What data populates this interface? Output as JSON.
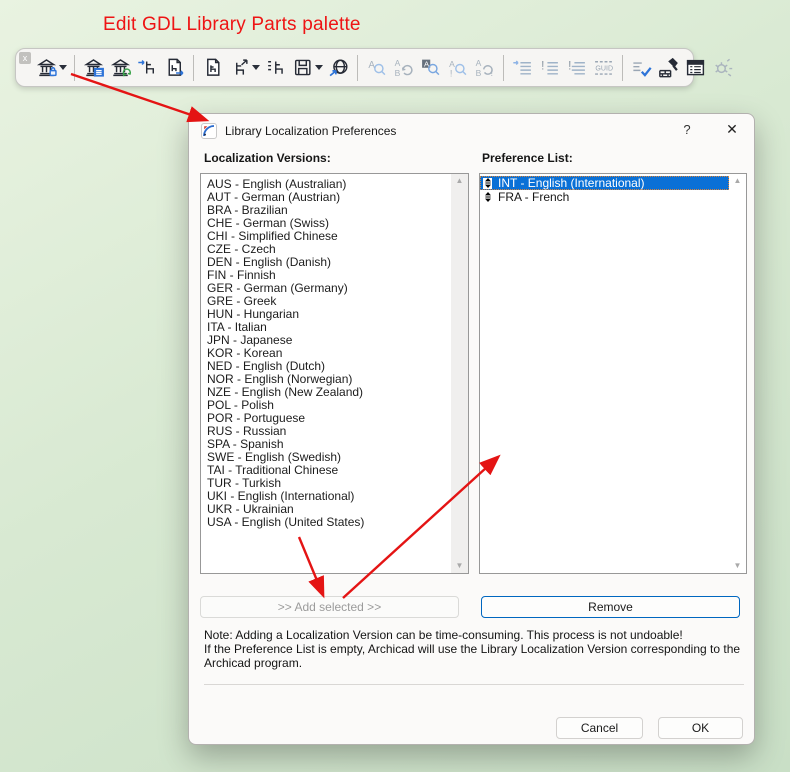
{
  "annotation": {
    "label": "Edit GDL Library Parts palette",
    "color": "#ee1414"
  },
  "toolbar": {
    "close_label": "x",
    "buttons": [
      {
        "name": "library-lock",
        "caret": true,
        "disabled": false
      },
      {
        "sep": true
      },
      {
        "name": "library-manager",
        "disabled": false
      },
      {
        "name": "reload-libraries",
        "disabled": false
      },
      {
        "name": "open-object",
        "disabled": false
      },
      {
        "name": "export-object",
        "disabled": false
      },
      {
        "sep": true
      },
      {
        "name": "new-object",
        "disabled": false
      },
      {
        "name": "open-object-subwindow",
        "caret": true,
        "disabled": false
      },
      {
        "name": "object-parameters",
        "disabled": false
      },
      {
        "name": "save-object",
        "caret": true,
        "disabled": false
      },
      {
        "name": "open-object-from-web",
        "disabled": false
      },
      {
        "sep": true
      },
      {
        "name": "find",
        "disabled": true
      },
      {
        "name": "find-replace",
        "disabled": true
      },
      {
        "name": "find-selection",
        "disabled": false
      },
      {
        "name": "find-next",
        "disabled": true
      },
      {
        "name": "replace-all",
        "disabled": true
      },
      {
        "sep": true
      },
      {
        "name": "indent-lines",
        "disabled": true
      },
      {
        "name": "comment-lines",
        "disabled": true
      },
      {
        "name": "uncomment-lines",
        "disabled": true
      },
      {
        "name": "insert-guid",
        "disabled": true
      },
      {
        "sep": true
      },
      {
        "name": "check-script",
        "disabled": false
      },
      {
        "name": "rebuild",
        "disabled": false
      },
      {
        "name": "editor-grid",
        "disabled": false
      },
      {
        "name": "debug",
        "disabled": true
      }
    ]
  },
  "dialog": {
    "title": "Library Localization Preferences",
    "title_icon": "archicad-logo-icon",
    "help_label": "?",
    "close_label": "✕",
    "left_list": {
      "label": "Localization Versions:",
      "items": [
        "AUS - English (Australian)",
        "AUT - German (Austrian)",
        "BRA - Brazilian",
        "CHE - German (Swiss)",
        "CHI - Simplified Chinese",
        "CZE - Czech",
        "DEN - English (Danish)",
        "FIN - Finnish",
        "GER - German (Germany)",
        "GRE - Greek",
        "HUN - Hungarian",
        "ITA - Italian",
        "JPN - Japanese",
        "KOR - Korean",
        "NED - English (Dutch)",
        "NOR - English (Norwegian)",
        "NZE - English (New Zealand)",
        "POL - Polish",
        "POR - Portuguese",
        "RUS - Russian",
        "SPA - Spanish",
        "SWE - English (Swedish)",
        "TAI - Traditional Chinese",
        "TUR - Turkish",
        "UKI - English (International)",
        "UKR - Ukrainian",
        "USA - English (United States)"
      ]
    },
    "right_list": {
      "label": "Preference List:",
      "items": [
        {
          "label": "INT - English (International)",
          "selected": true
        },
        {
          "label": "FRA - French",
          "selected": false
        }
      ]
    },
    "buttons": {
      "add": ">> Add selected >>",
      "remove": "Remove",
      "cancel": "Cancel",
      "ok": "OK"
    },
    "note": "Note: Adding a Localization Version can be time-consuming. This process is not undoable!\nIf the Preference List is empty, Archicad will use the Library Localization Version corresponding to the\nArchicad program.",
    "selection_color": "#0a70d6"
  },
  "icons": {
    "scroll_up": "▲",
    "scroll_down": "▼"
  },
  "arrow_color": "#e41414"
}
